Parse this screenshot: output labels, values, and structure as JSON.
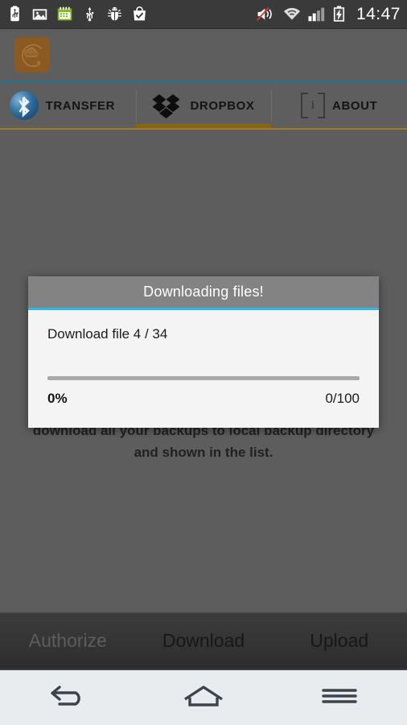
{
  "status_bar": {
    "time": "14:47",
    "left_icons": [
      {
        "name": "usb-battery-icon"
      },
      {
        "name": "gallery-image-icon"
      },
      {
        "name": "calendar-icon"
      },
      {
        "name": "usb-icon"
      },
      {
        "name": "usb-debug-bug-icon"
      },
      {
        "name": "play-store-bag-check-icon"
      }
    ],
    "right_icons": [
      {
        "name": "volume-muted-icon"
      },
      {
        "name": "wifi-icon"
      },
      {
        "name": "cellular-signal-icon"
      },
      {
        "name": "battery-charging-icon"
      }
    ]
  },
  "app_header": {
    "icon_name": "backup-cloud-app-icon",
    "icon_color": "#8a5a22"
  },
  "tabs": [
    {
      "label": "TRANSFER",
      "icon": "bluetooth-icon",
      "selected": false
    },
    {
      "label": "DROPBOX",
      "icon": "dropbox-icon",
      "selected": true
    },
    {
      "label": "ABOUT",
      "icon": "info-icon",
      "selected": false
    }
  ],
  "tab_accent_color": "#8a6415",
  "content": {
    "background_text": "download all your backups to local backup directory and shown in the list."
  },
  "dialog": {
    "title": "Downloading files!",
    "accent_color": "#33b5e5",
    "message": "Download file 4 / 34",
    "progress_percent_label": "0%",
    "progress_count_label": "0/100",
    "progress_value": 0
  },
  "action_bar": {
    "buttons": [
      {
        "label": "Authorize",
        "disabled": true
      },
      {
        "label": "Download",
        "disabled": false
      },
      {
        "label": "Upload",
        "disabled": false
      }
    ]
  },
  "nav_bar": {
    "buttons": [
      {
        "name": "back-icon"
      },
      {
        "name": "home-icon"
      },
      {
        "name": "menu-icon"
      }
    ]
  }
}
